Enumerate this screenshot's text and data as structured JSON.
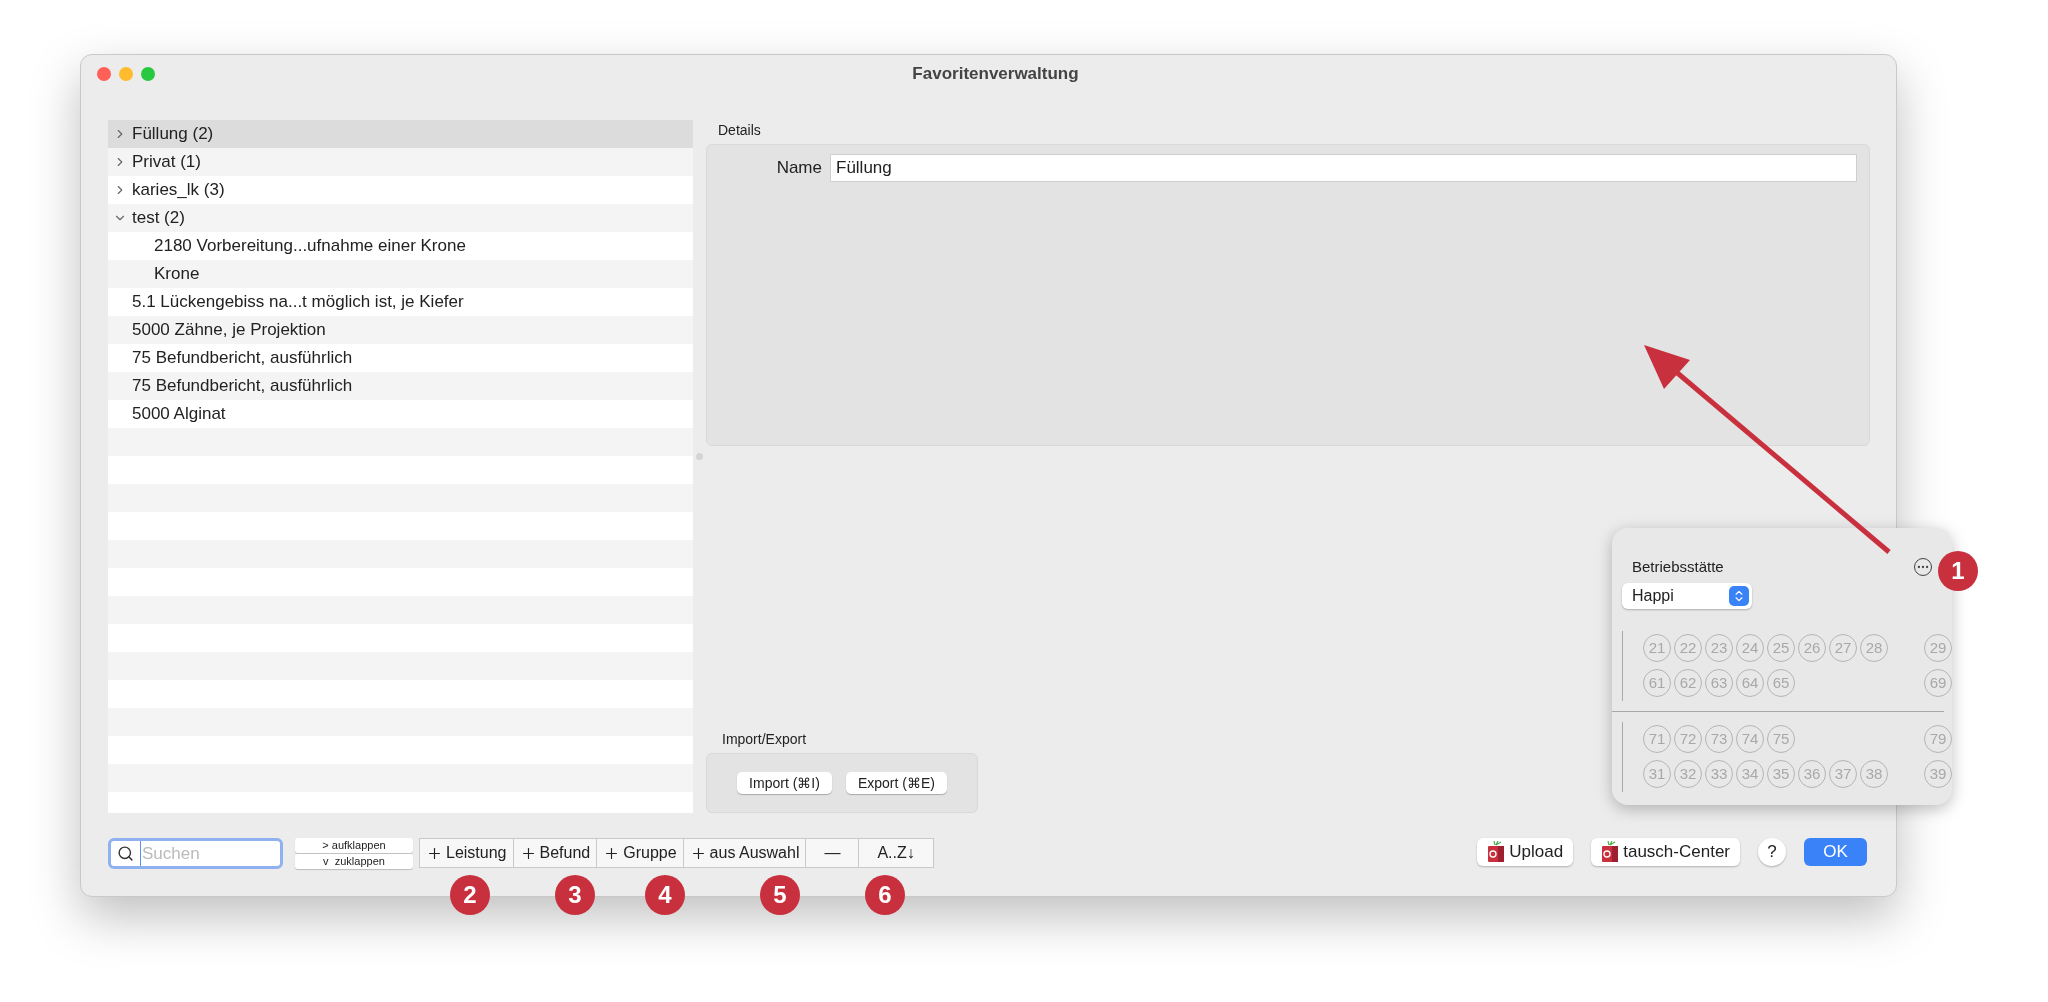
{
  "window": {
    "title": "Favoritenverwaltung"
  },
  "tree": {
    "items": [
      {
        "kind": "group",
        "label": "Füllung (2)",
        "expanded": false,
        "selected": true
      },
      {
        "kind": "group",
        "label": "Privat (1)",
        "expanded": false,
        "selected": false
      },
      {
        "kind": "group",
        "label": "karies_lk (3)",
        "expanded": false,
        "selected": false
      },
      {
        "kind": "group",
        "label": "test (2)",
        "expanded": true,
        "selected": false,
        "children": [
          {
            "label": "2180 Vorbereitung...ufnahme einer Krone",
            "selected": false
          },
          {
            "label": "Krone",
            "selected": false
          }
        ]
      },
      {
        "kind": "entry",
        "label": "5.1 Lückengebiss na...t möglich ist, je Kiefer",
        "selected": false
      },
      {
        "kind": "entry",
        "label": "5000 Zähne, je Projektion",
        "selected": false
      },
      {
        "kind": "entry",
        "label": "75 Befundbericht, ausführlich",
        "selected": false
      },
      {
        "kind": "entry",
        "label": "75 Befundbericht, ausführlich",
        "selected": false
      },
      {
        "kind": "entry",
        "label": "5000 Alginat",
        "selected": false
      }
    ]
  },
  "details": {
    "title": "Details",
    "name_label": "Name",
    "name_value": "Füllung"
  },
  "import_export": {
    "title": "Import/Export",
    "buttons": [
      "Import (⌘I)",
      "Export (⌘E)"
    ]
  },
  "search": {
    "placeholder": "Suchen"
  },
  "expand_buttons": [
    "> aufklappen",
    "v  zuklappen"
  ],
  "toolbar": [
    {
      "kind": "add",
      "label": "Leistung"
    },
    {
      "kind": "add",
      "label": "Befund"
    },
    {
      "kind": "add",
      "label": "Gruppe"
    },
    {
      "kind": "add",
      "label": "aus Auswahl"
    },
    {
      "kind": "text",
      "label": "—"
    },
    {
      "kind": "text",
      "label": "A..Z↓"
    }
  ],
  "footer_buttons": [
    {
      "kind": "app",
      "label": "Upload"
    },
    {
      "kind": "app",
      "label": "tausch-Center"
    },
    {
      "kind": "help",
      "label": "?"
    },
    {
      "kind": "primary",
      "label": "OK"
    }
  ],
  "popover": {
    "title": "Betriebsstätte",
    "select": {
      "value": "Happi"
    },
    "upper_rows": [
      {
        "teeth": [
          "21",
          "22",
          "23",
          "24",
          "25",
          "26",
          "27",
          "28"
        ],
        "end": "29"
      },
      {
        "teeth": [
          "61",
          "62",
          "63",
          "64",
          "65"
        ],
        "end": "69"
      }
    ],
    "lower_rows": [
      {
        "teeth": [
          "71",
          "72",
          "73",
          "74",
          "75"
        ],
        "end": "79"
      },
      {
        "teeth": [
          "31",
          "32",
          "33",
          "34",
          "35",
          "36",
          "37",
          "38"
        ],
        "end": "39"
      }
    ]
  },
  "annotations": [
    "1",
    "2",
    "3",
    "4",
    "5",
    "6"
  ]
}
